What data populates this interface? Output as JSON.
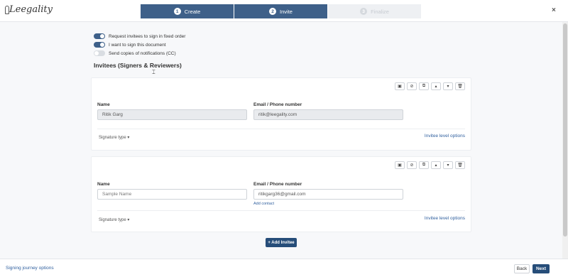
{
  "brand": {
    "logo_text": "Leegality"
  },
  "steps": [
    {
      "num": "1",
      "label": "Create"
    },
    {
      "num": "2",
      "label": "Invite"
    },
    {
      "num": "3",
      "label": "Finalize"
    }
  ],
  "close_glyph": "×",
  "options": {
    "fixed_order": "Request invitees to sign in fixed order",
    "i_sign": "I want to sign this document",
    "cc": "Send copies of notifications (CC)"
  },
  "section_title": "Invitees (Signers & Reviewers)",
  "invitees": [
    {
      "name_label": "Name",
      "name_value": "Ritik Garg",
      "email_label": "Email / Phone number",
      "email_value": "ritik@leegality.com",
      "signature_type": "Signature type ▾",
      "level_options": "Invitee level options"
    },
    {
      "name_label": "Name",
      "name_placeholder": "Sample Name",
      "email_label": "Email / Phone number",
      "email_value": "ritikgarg36@gmail.com",
      "add_contact": "Add contact",
      "signature_type": "Signature type ▾",
      "level_options": "Invitee level options"
    }
  ],
  "add_invitee": "+ Add Invitee",
  "footer": {
    "journey_options": "Signing journey options",
    "back": "Back",
    "next": "Next"
  },
  "colors": {
    "primary": "#3e6089",
    "button_dark": "#264d79",
    "link": "#2f5f9e"
  }
}
